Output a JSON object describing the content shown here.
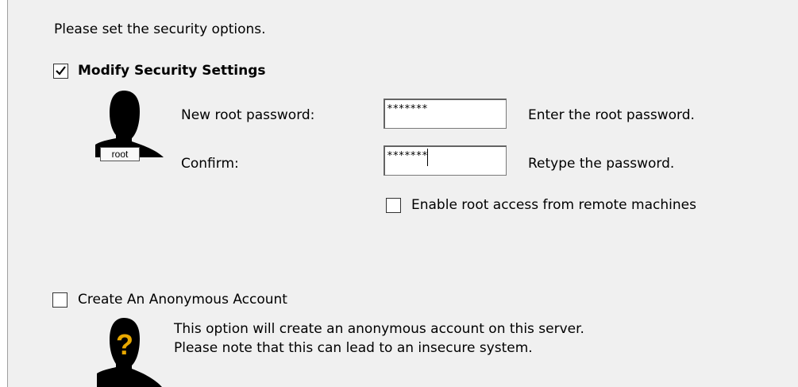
{
  "intro": "Please set the security options.",
  "security": {
    "modify_label": "Modify Security Settings",
    "modify_checked": true,
    "root_tag": "root",
    "new_password_label": "New root password:",
    "new_password_value": "*******",
    "new_password_hint": "Enter the root password.",
    "confirm_label": "Confirm:",
    "confirm_value": "*******",
    "confirm_hint": "Retype the password.",
    "remote_label": "Enable root access from remote machines",
    "remote_checked": false
  },
  "anonymous": {
    "label": "Create An Anonymous Account",
    "checked": false,
    "line1": "This option will create an anonymous account on this server.",
    "line2": "Please note that this can lead to an insecure system."
  },
  "icons": {
    "root_user": "user-silhouette-icon",
    "anonymous_user": "question-user-icon"
  },
  "colors": {
    "panel_bg": "#f0f0f0",
    "question_mark": "#e8a800"
  }
}
